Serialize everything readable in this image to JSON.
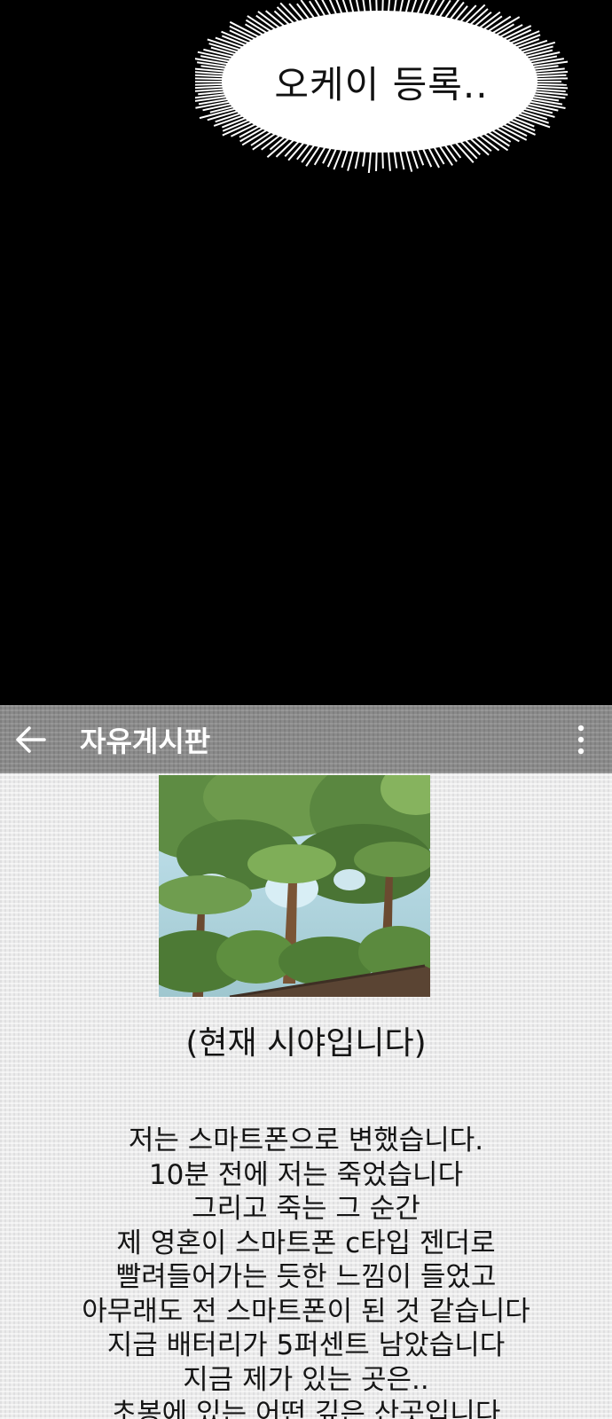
{
  "speech_bubble": {
    "text": "오케이 등록.."
  },
  "app": {
    "back_icon": "arrow-left-icon",
    "title": "자유게시판",
    "more_icon": "more-vertical-icon",
    "bar_color": "#8a8a8a"
  },
  "post": {
    "image_description_icon": "forest-photo",
    "caption": "(현재 시야입니다)",
    "lines": [
      "저는 스마트폰으로 변했습니다.",
      "10분 전에 저는 죽었습니다",
      "그리고 죽는 그 순간",
      "제 영혼이 스마트폰 c타입 젠더로",
      "빨려들어가는 듯한 느낌이 들었고",
      "아무래도 전 스마트폰이 된 것 같습니다",
      "지금 배터리가 5퍼센트 남았습니다",
      "지금 제가 있는 곳은..",
      "초봉에 있는 어떤 깊은 산곳입니다"
    ]
  }
}
